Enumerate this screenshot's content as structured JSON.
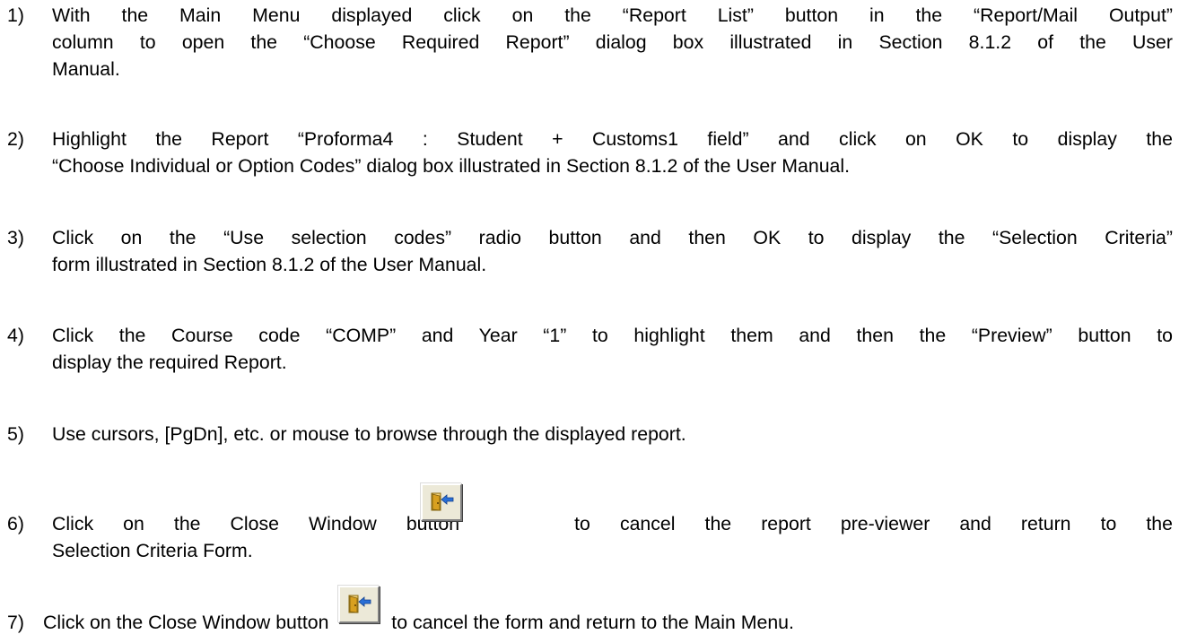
{
  "heading_fragment": "",
  "steps": [
    {
      "number": "1)",
      "lines": [
        "With the Main Menu displayed click on the “Report List” button in the “Report/Mail Output”",
        "column to open the “Choose Required Report” dialog box illustrated in Section 8.1.2 of the User",
        "Manual."
      ]
    },
    {
      "number": "2)",
      "lines": [
        "Highlight the Report  “Proforma4 : Student + Customs1 field” and click on OK to display the",
        "“Choose Individual or Option Codes” dialog box illustrated in Section 8.1.2 of the User Manual."
      ]
    },
    {
      "number": "3)",
      "lines": [
        "Click on the “Use selection codes” radio button and then OK to display the “Selection Criteria”",
        "form illustrated in Section 8.1.2 of the User Manual."
      ]
    },
    {
      "number": "4)",
      "lines": [
        "Click the Course code “COMP” and Year “1” to highlight them and then the “Preview” button to",
        "display the required Report."
      ]
    },
    {
      "number": "5)",
      "lines": [
        "Use cursors,  [PgDn], etc. or mouse to browse through the displayed report."
      ]
    },
    {
      "number": "6)",
      "before_icon": "Click on the Close Window button",
      "after_icon": "to cancel the report pre-viewer and return to the",
      "second_line": "Selection Criteria Form."
    },
    {
      "number": "7)",
      "before_icon": "Click on the Close Window button",
      "after_icon": "to cancel the form and return to the Main Menu."
    }
  ],
  "icon": {
    "name": "close-window-icon",
    "door_color": "#d8a020",
    "arrow_color": "#2a6fd6"
  }
}
